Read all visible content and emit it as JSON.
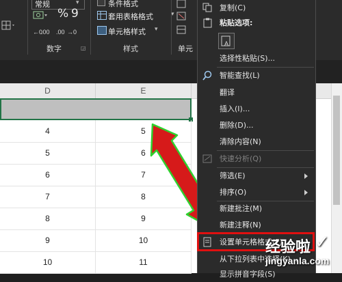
{
  "ribbon": {
    "number_format": "常规",
    "percent": "%",
    "comma": "9",
    "conditional_format": "条件格式",
    "table_format": "套用表格格式",
    "cell_style": "单元格样式",
    "group_number": "数字",
    "group_styles": "样式",
    "group_cells": "单元"
  },
  "columns": [
    "D",
    "E"
  ],
  "rows": [
    {
      "d": "",
      "e": ""
    },
    {
      "d": "4",
      "e": "5"
    },
    {
      "d": "5",
      "e": "6"
    },
    {
      "d": "6",
      "e": "7"
    },
    {
      "d": "7",
      "e": "8"
    },
    {
      "d": "8",
      "e": "9"
    },
    {
      "d": "9",
      "e": "10"
    },
    {
      "d": "10",
      "e": "11"
    }
  ],
  "menu": {
    "copy": "复制(C)",
    "paste_options": "粘贴选项:",
    "paste_special": "选择性粘贴(S)...",
    "smart_lookup": "智能查找(L)",
    "translate": "翻译",
    "insert": "插入(I)...",
    "delete": "删除(D)...",
    "clear": "清除内容(N)",
    "quick_analysis": "快速分析(Q)",
    "filter": "筛选(E)",
    "sort": "排序(O)",
    "new_comment": "新建批注(M)",
    "new_note": "新建注释(N)",
    "format_cells": "设置单元格格式(F)...",
    "pick_list": "从下拉列表中选择(K)...",
    "phonetic": "显示拼音字段(S)"
  },
  "colors": {
    "highlight_border": "#e01010",
    "arrow_fill": "#d61a1a",
    "arrow_outline": "#2fd12f",
    "selection": "#217346"
  },
  "watermark": {
    "main": "经验啦",
    "url": "jingyanla.com",
    "check": "✓"
  }
}
